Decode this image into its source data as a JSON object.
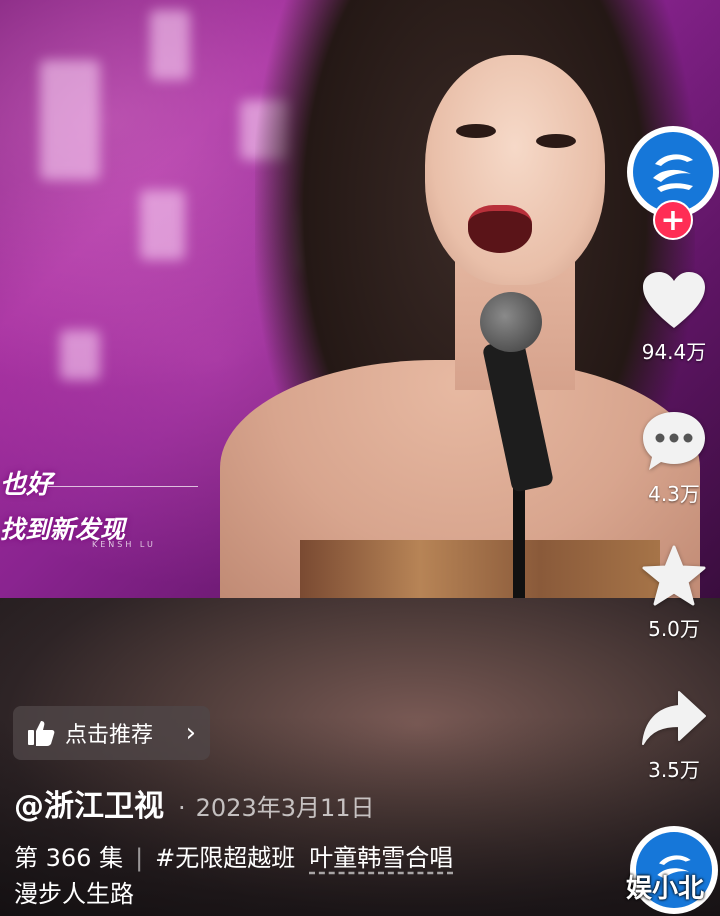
{
  "video": {
    "subtitle_line1": "也好",
    "subtitle_line2": "找到新发现",
    "subtitle_small": "KENSH    LU"
  },
  "sidebar": {
    "like_count": "94.4万",
    "comment_count": "4.3万",
    "favorite_count": "5.0万",
    "share_count": "3.5万",
    "follow_symbol": "+"
  },
  "recommend": {
    "label": "点击推荐",
    "chevron": "›"
  },
  "post": {
    "author": "@浙江卫视",
    "date_separator": "·",
    "date": "2023年3月11日",
    "episode": "第 366 集",
    "divider": "|",
    "hashtag": "#无限超越班",
    "keyword": "叶童韩雪合唱",
    "line2": "漫步人生路"
  },
  "watermark": "娱小北",
  "colors": {
    "accent": "#ff2d55",
    "brand_blue": "#1677d9"
  }
}
